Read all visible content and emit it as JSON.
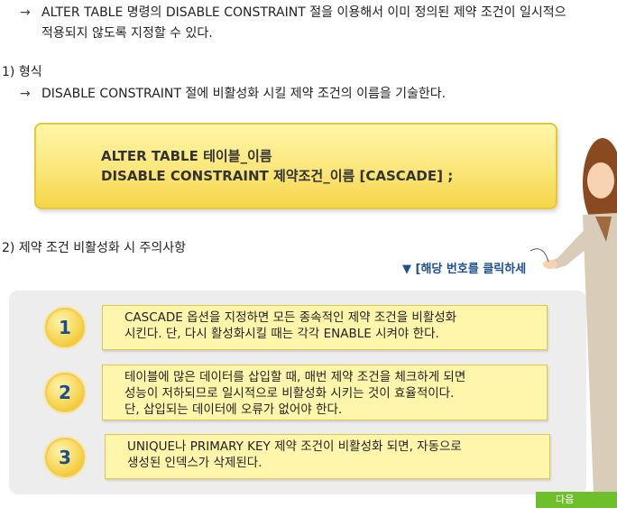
{
  "intro": {
    "arrow": "→",
    "line1": "ALTER TABLE 명령의 DISABLE CONSTRAINT 절을 이용해서 이미 정의된 제약 조건이 일시적으",
    "line2": "적용되지 않도록 지정할 수 있다."
  },
  "section1": {
    "title": "1) 형식",
    "arrow": "→",
    "desc": "DISABLE CONSTRAINT 절에 비활성화 시킬 제약 조건의 이름을 기술한다.",
    "code_line1": "ALTER   TABLE   테이블_이름",
    "code_line2": "DISABLE CONSTRAINT 제약조건_이름 [CASCADE] ;"
  },
  "section2": {
    "title": "2) 제약 조건 비활성화 시 주의사항",
    "hint": "▼ [해당 번호를 클릭하세",
    "items": [
      {
        "num": "1",
        "lines": [
          "CASCADE 옵션을 지정하면 모든 종속적인 제약 조건을 비활성화",
          "시킨다. 단, 다시 활성화시킬 때는 각각 ENABLE 시켜야 한다."
        ]
      },
      {
        "num": "2",
        "lines": [
          "테이블에 많은 데이터를 삽입할 때, 매번 제약 조건을 체크하게 되면",
          "성능이 저하되므로 일시적으로 비활성화 시키는 것이 효율적이다.",
          "단, 삽입되는 데이터에 오류가 없어야 한다."
        ]
      },
      {
        "num": "3",
        "lines": [
          "UNIQUE나 PRIMARY KEY 제약 조건이 비활성화 되면, 자동으로",
          "생성된 인덱스가 삭제된다."
        ]
      }
    ]
  },
  "nav": {
    "next_label": "다음"
  },
  "colors": {
    "code_box": "#fbe67a",
    "item_box": "#fff6ac",
    "panel": "#ededed",
    "hint": "#1c4f8f",
    "next": "#6fbf2c"
  }
}
